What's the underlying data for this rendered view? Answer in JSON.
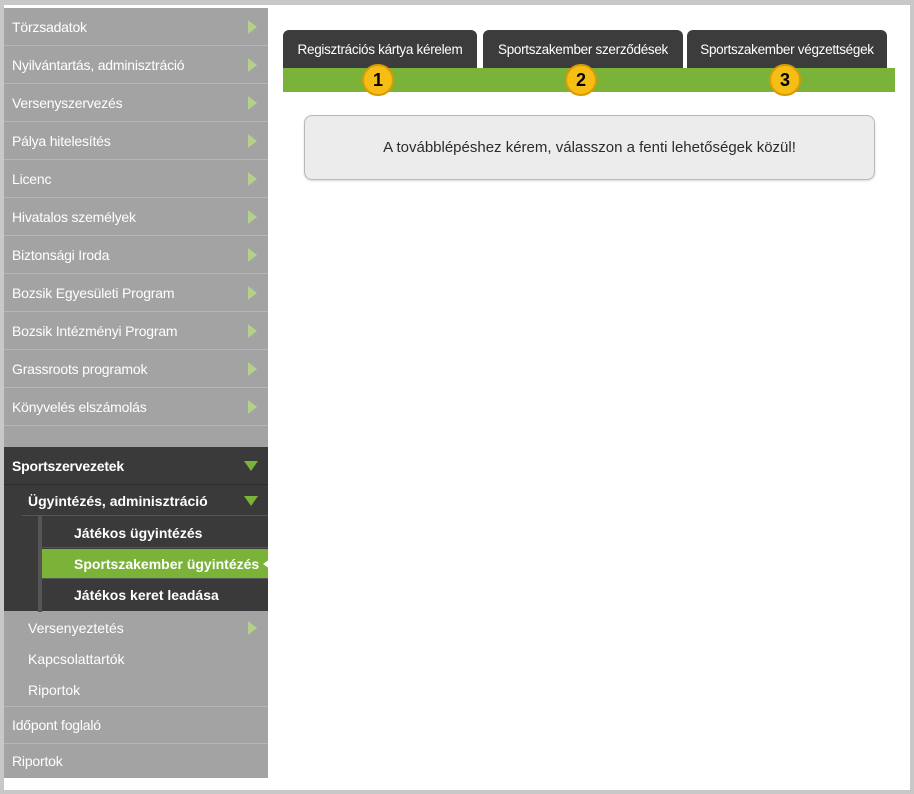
{
  "sidebar": {
    "items": [
      {
        "label": "Törzsadatok"
      },
      {
        "label": "Nyilvántartás, adminisztráció"
      },
      {
        "label": "Versenyszervezés"
      },
      {
        "label": "Pálya hitelesítés"
      },
      {
        "label": "Licenc"
      },
      {
        "label": "Hivatalos személyek"
      },
      {
        "label": "Biztonsági Iroda"
      },
      {
        "label": "Bozsik Egyesületi Program"
      },
      {
        "label": "Bozsik Intézményi Program"
      },
      {
        "label": "Grassroots programok"
      },
      {
        "label": "Könyvelés elszámolás"
      }
    ],
    "open_section": {
      "label": "Sportszervezetek",
      "subsection": {
        "label": "Ügyintézés, adminisztráció",
        "items": [
          {
            "label": "Játékos ügyintézés"
          },
          {
            "label": "Sportszakember ügyintézés"
          },
          {
            "label": "Játékos keret leadása"
          }
        ]
      },
      "other_items": [
        {
          "label": "Versenyeztetés"
        },
        {
          "label": "Kapcsolattartók"
        },
        {
          "label": "Riportok"
        }
      ]
    },
    "bottom_items": [
      {
        "label": "Időpont foglaló"
      },
      {
        "label": "Riportok"
      }
    ]
  },
  "tabs": [
    {
      "label": "Regisztrációs kártya kérelem",
      "marker": "1"
    },
    {
      "label": "Sportszakember szerződések",
      "marker": "2"
    },
    {
      "label": "Sportszakember végzettségek",
      "marker": "3"
    }
  ],
  "message": "A továbblépéshez kérem, válasszon a fenti lehetőségek közül!",
  "colors": {
    "accent_green": "#7ab338",
    "marker_yellow": "#f6bd17",
    "tab_dark": "#3c3c3c",
    "sidebar_gray": "#a3a3a3"
  }
}
